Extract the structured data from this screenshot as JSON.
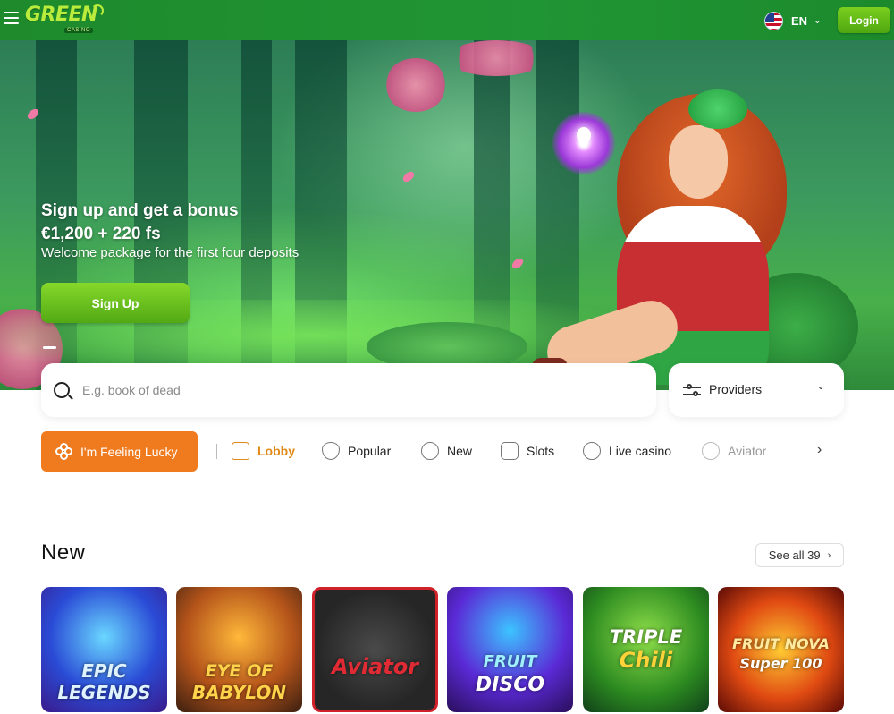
{
  "header": {
    "logo_text": "GREEN",
    "logo_sub": "CASINO",
    "language": "EN",
    "login_label": "Login"
  },
  "hero": {
    "title_line1": "Sign up and get a bonus",
    "title_line2": "€1,200 + 220 fs",
    "subtitle": "Welcome package for the first four deposits",
    "signup_label": "Sign Up"
  },
  "search": {
    "placeholder": "E.g. book of dead"
  },
  "providers": {
    "label": "Providers"
  },
  "categories": {
    "lucky_label": "I'm Feeling Lucky",
    "items": [
      {
        "label": "Lobby"
      },
      {
        "label": "Popular"
      },
      {
        "label": "New"
      },
      {
        "label": "Slots"
      },
      {
        "label": "Live casino"
      },
      {
        "label": "Aviator"
      }
    ]
  },
  "new_section": {
    "title": "New",
    "see_all_label": "See all 39",
    "games": [
      {
        "name_line1": "EPIC",
        "name_line2": "LEGENDS"
      },
      {
        "name_line1": "EYE OF",
        "name_line2": "BABYLON"
      },
      {
        "name_line1": "Aviator",
        "name_line2": ""
      },
      {
        "name_line1": "FRUIT",
        "name_line2": "DISCO"
      },
      {
        "name_line1": "TRIPLE",
        "name_line2": "Chili"
      },
      {
        "name_line1": "FRUIT NOVA",
        "name_line2": "Super 100"
      }
    ]
  },
  "colors": {
    "header_green": "#1e8a2c",
    "cta_green": "#6cc11f",
    "lucky_orange": "#f07a1e",
    "active_category": "#e08a1a"
  }
}
